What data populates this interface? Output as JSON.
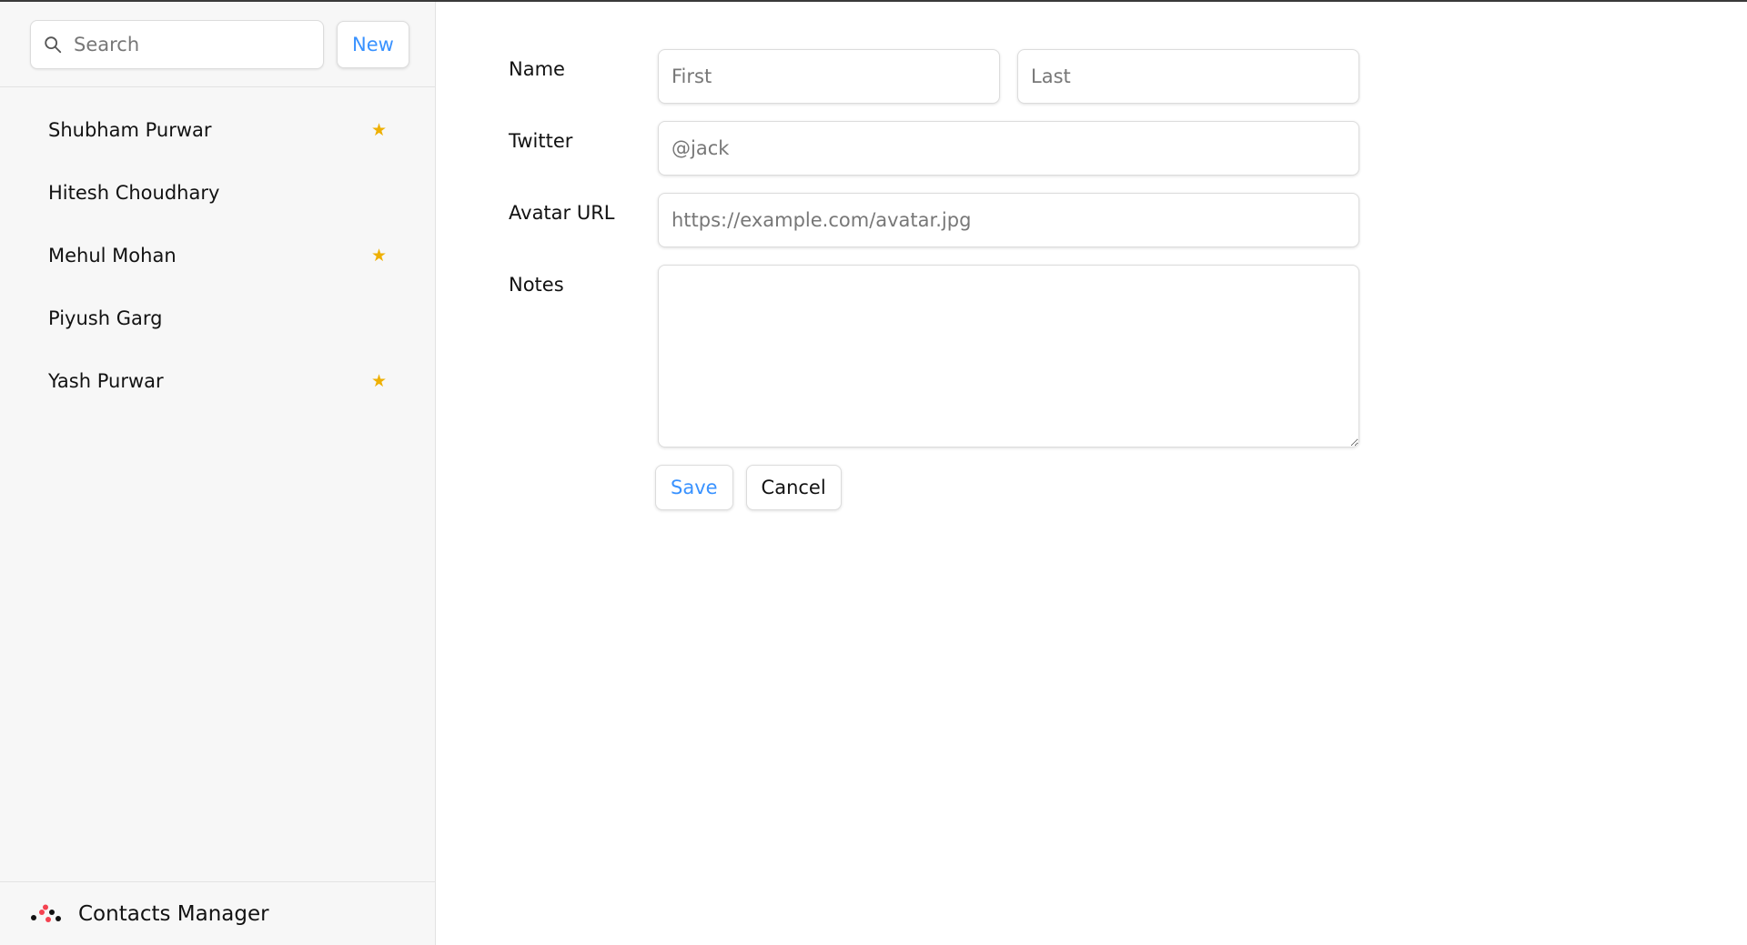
{
  "sidebar": {
    "search": {
      "placeholder": "Search",
      "value": ""
    },
    "new_button_label": "New",
    "contacts": [
      {
        "name": "Shubham Purwar",
        "favorite": true
      },
      {
        "name": "Hitesh Choudhary",
        "favorite": false
      },
      {
        "name": "Mehul Mohan",
        "favorite": true
      },
      {
        "name": "Piyush Garg",
        "favorite": false
      },
      {
        "name": "Yash Purwar",
        "favorite": true
      }
    ],
    "footer": {
      "app_name": "Contacts Manager",
      "logo_icon": "dots-logo-icon"
    }
  },
  "form": {
    "name_label": "Name",
    "first_placeholder": "First",
    "last_placeholder": "Last",
    "twitter_label": "Twitter",
    "twitter_placeholder": "@jack",
    "avatar_label": "Avatar URL",
    "avatar_placeholder": "https://example.com/avatar.jpg",
    "notes_label": "Notes",
    "notes_value": "",
    "save_label": "Save",
    "cancel_label": "Cancel"
  },
  "colors": {
    "accent": "#3992ff",
    "star": "#eeb004",
    "sidebar_bg": "#f7f7f7",
    "logo_red": "#f44250"
  },
  "icons": {
    "search": "search-icon",
    "favorite": "star-icon"
  }
}
